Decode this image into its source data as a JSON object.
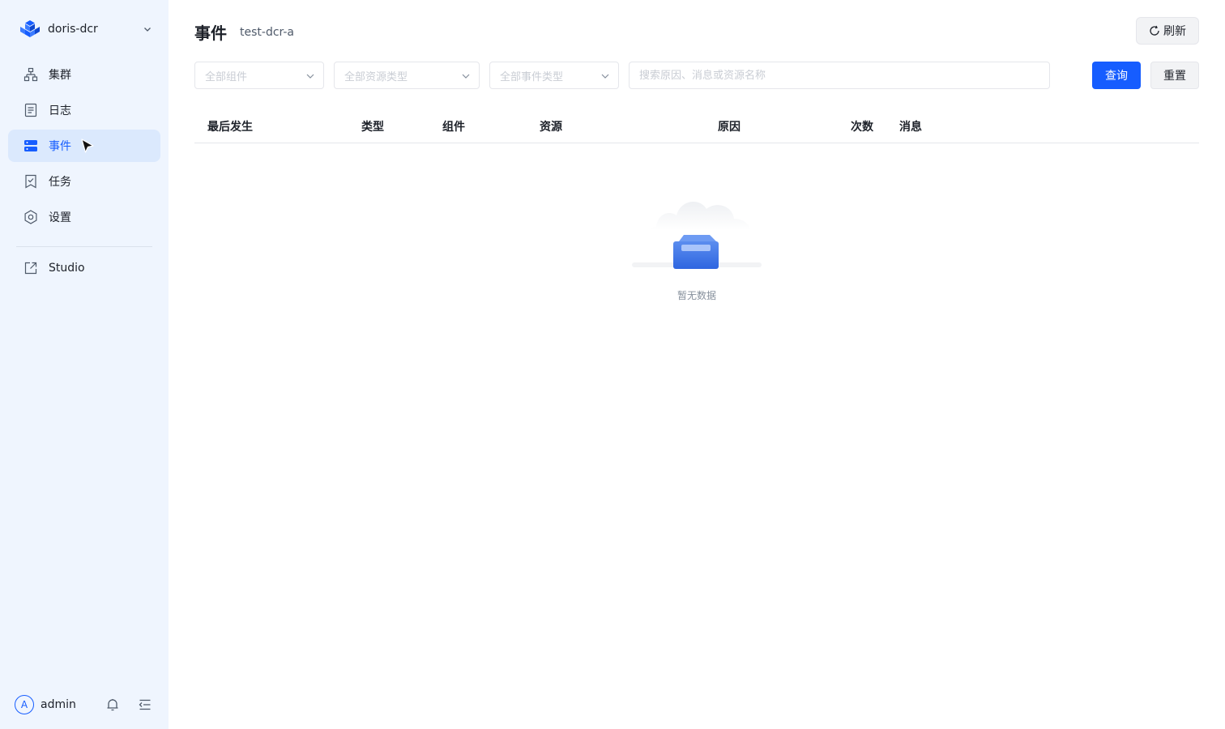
{
  "sidebar": {
    "brand": {
      "name": "doris-dcr"
    },
    "nav": [
      {
        "key": "cluster",
        "label": "集群",
        "icon": "cluster-icon",
        "active": false
      },
      {
        "key": "log",
        "label": "日志",
        "icon": "log-icon",
        "active": false
      },
      {
        "key": "event",
        "label": "事件",
        "icon": "event-icon",
        "active": true
      },
      {
        "key": "task",
        "label": "任务",
        "icon": "task-icon",
        "active": false
      },
      {
        "key": "settings",
        "label": "设置",
        "icon": "gear-icon",
        "active": false
      }
    ],
    "studio": {
      "label": "Studio",
      "icon": "external-link-icon"
    },
    "user": {
      "avatar_letter": "A",
      "name": "admin"
    }
  },
  "header": {
    "title": "事件",
    "cluster": "test-dcr-a",
    "refresh_label": "刷新"
  },
  "filters": {
    "component_placeholder": "全部组件",
    "resource_type_placeholder": "全部资源类型",
    "event_type_placeholder": "全部事件类型",
    "search_placeholder": "搜索原因、消息或资源名称",
    "query_label": "查询",
    "reset_label": "重置"
  },
  "table": {
    "columns": [
      "最后发生",
      "类型",
      "组件",
      "资源",
      "原因",
      "次数",
      "消息"
    ],
    "rows": [],
    "empty_text": "暂无数据"
  },
  "colors": {
    "primary": "#165dff",
    "sidebar_bg": "#eff5fe",
    "active_bg": "#dbe9fd"
  }
}
